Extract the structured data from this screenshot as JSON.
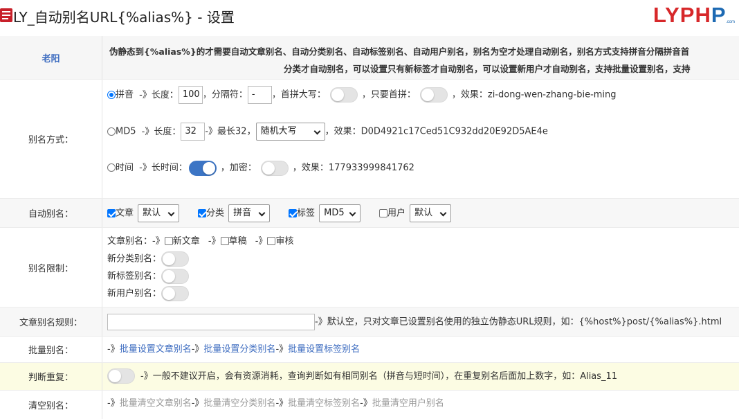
{
  "header": {
    "title": "LY_自动别名URL{%alias%} - 设置",
    "logo_left": "LYPH",
    "logo_right": "P",
    "logo_sub": ".com"
  },
  "top": {
    "label": "老阳",
    "desc_line1": "伪静态到{%alias%}的才需要自动文章别名、自动分类别名、自动标签别名、自动用户别名，别名为空才处理自动别名，别名方式支持拼音分隔拼音首",
    "desc_line2": "分类才自动别名，可以设置只有新标签才自动别名，可以设置新用户才自动别名，支持批量设置别名，支持"
  },
  "alias_mode": {
    "label": "别名方式：",
    "pinyin": {
      "name": "拼音",
      "arrow": "-》长度：",
      "length": "100",
      "sep_label": "，分隔符：",
      "sep": "-",
      "cap_label": "，首拼大写：",
      "first_label": "，只要首拼：",
      "effect_label": "，效果：",
      "effect": "zi-dong-wen-zhang-bie-ming"
    },
    "md5": {
      "name": "MD5",
      "arrow": "-》长度：",
      "length": "32",
      "max": "-》最长32，",
      "case": "随机大写",
      "effect_label": "，效果：",
      "effect": "D0D4921c17Ced51C932dd20E92D5AE4e"
    },
    "time": {
      "name": "时间",
      "arrow": "-》长时间：",
      "enc_label": "，加密：",
      "effect_label": "，效果：",
      "effect": "177933999841762"
    }
  },
  "auto_alias": {
    "label": "自动别名：",
    "items": [
      {
        "name": "文章",
        "value": "默认"
      },
      {
        "name": "分类",
        "value": "拼音"
      },
      {
        "name": "标签",
        "value": "MD5"
      },
      {
        "name": "用户",
        "value": "默认"
      }
    ]
  },
  "limit": {
    "label": "别名限制：",
    "article_label": "文章别名：",
    "arrow": "-》",
    "new_article": "新文章",
    "draft": "草稿",
    "review": "审核",
    "new_cat": "新分类别名：",
    "new_tag": "新标签别名：",
    "new_user": "新用户别名："
  },
  "rule": {
    "label": "文章别名规则：",
    "hint": "-》默认空，只对文章已设置别名使用的独立伪静态URL规则，如：{%host%}post/{%alias%}.html",
    "value": ""
  },
  "batch": {
    "label": "批量别名：",
    "arrow": "-》",
    "links": [
      "批量设置文章别名",
      "批量设置分类别名",
      "批量设置标签别名"
    ]
  },
  "dup": {
    "label": "判断重复：",
    "hint": "-》一般不建议开启，会有资源消耗，查询判断如有相同别名（拼音与短时间），在重复别名后面加上数字，如：Alias_11"
  },
  "clear": {
    "label": "清空别名：",
    "arrow": "-》",
    "links": [
      "批量清空文章别名",
      "批量清空分类别名",
      "批量清空标签别名",
      "批量清空用户别名"
    ]
  }
}
